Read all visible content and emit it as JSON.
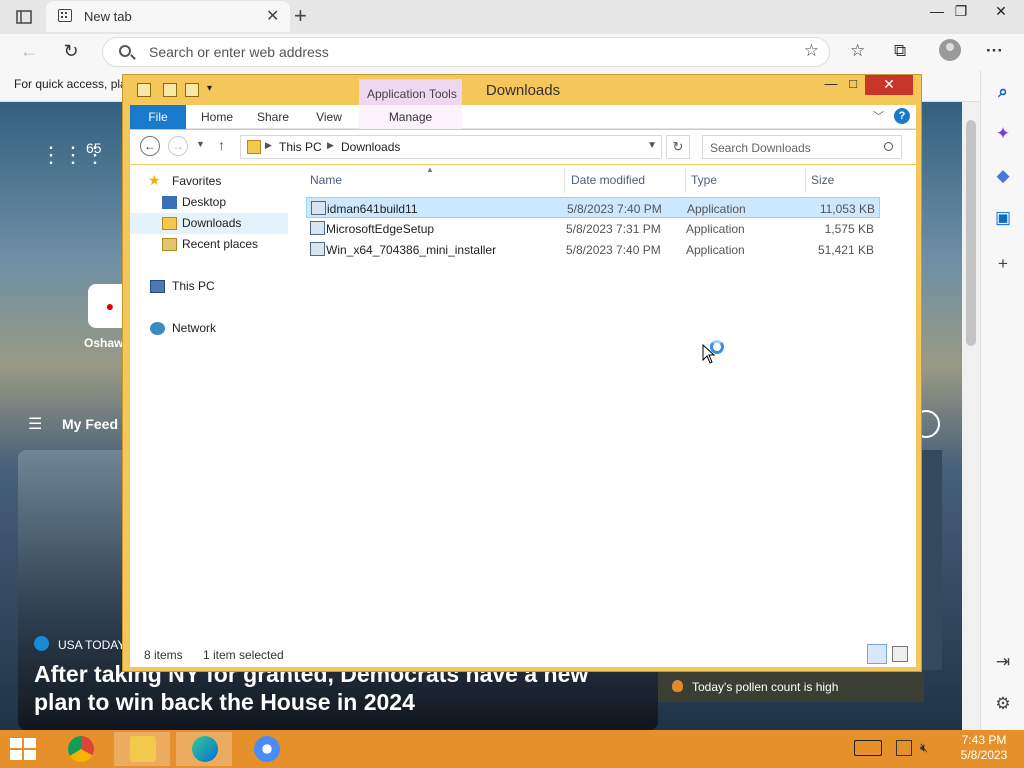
{
  "browser": {
    "tab_title": "New tab",
    "tab_close": "✕",
    "new_tab": "+",
    "window_min": "—",
    "window_restore": "❐",
    "window_close": "✕",
    "address_placeholder": "Search or enter web address",
    "bookmarks_text": "For quick access, pla",
    "more_label": "···"
  },
  "ntp": {
    "weather_temp": "65",
    "tile_label": "Oshawa",
    "feed_label": "My Feed",
    "news_source": "USA TODAY",
    "news_headline": "After taking NY for granted, Democrats have a new plan to win back the House in 2024",
    "pollen_text": "Today's pollen count is high"
  },
  "explorer": {
    "title": "Downloads",
    "context_tab": "Application Tools",
    "ribbon_tabs": [
      "File",
      "Home",
      "Share",
      "View",
      "Manage"
    ],
    "breadcrumb": [
      "This PC",
      "Downloads"
    ],
    "search_placeholder": "Search Downloads",
    "nav": {
      "favorites": "Favorites",
      "desktop": "Desktop",
      "downloads": "Downloads",
      "recent": "Recent places",
      "this_pc": "This PC",
      "network": "Network"
    },
    "columns": [
      "Name",
      "Date modified",
      "Type",
      "Size"
    ],
    "files": [
      {
        "name": "idman641build11",
        "date": "5/8/2023 7:40 PM",
        "type": "Application",
        "size": "11,053 KB",
        "selected": true
      },
      {
        "name": "MicrosoftEdgeSetup",
        "date": "5/8/2023 7:31 PM",
        "type": "Application",
        "size": "1,575 KB",
        "selected": false
      },
      {
        "name": "Win_x64_704386_mini_installer",
        "date": "5/8/2023 7:40 PM",
        "type": "Application",
        "size": "51,421 KB",
        "selected": false
      }
    ],
    "status_items": "8 items",
    "status_selected": "1 item selected"
  },
  "taskbar": {
    "time": "7:43 PM",
    "date": "5/8/2023"
  },
  "colors": {
    "explorer_frame": "#f5c65a",
    "taskbar": "#e6902b",
    "file_tab": "#1979ca",
    "selection": "#cce8ff"
  }
}
